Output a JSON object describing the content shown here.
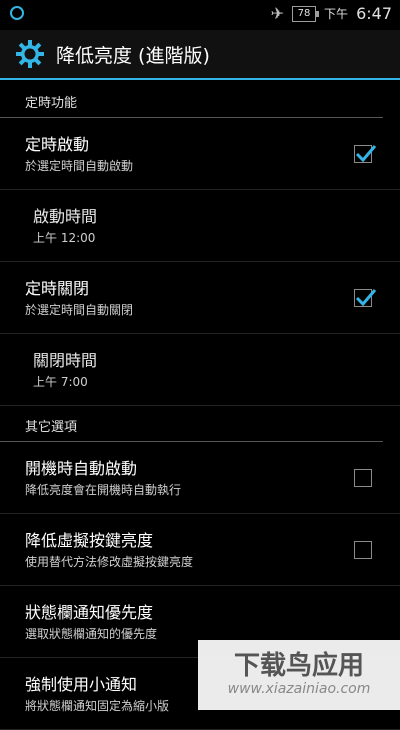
{
  "status_bar": {
    "battery": "78",
    "ampm": "下午",
    "time": "6:47",
    "icons": [
      "circle-status-icon",
      "airplane-icon",
      "battery-icon"
    ]
  },
  "action_bar": {
    "title": "降低亮度 (進階版)",
    "icon": "gear-icon"
  },
  "sections": [
    {
      "header": "定時功能",
      "items": [
        {
          "title": "定時啟動",
          "summary": "於選定時間自動啟動",
          "checked": true
        },
        {
          "title": "啟動時間",
          "summary": "上午 12:00"
        },
        {
          "title": "定時關閉",
          "summary": "於選定時間自動關閉",
          "checked": true
        },
        {
          "title": "關閉時間",
          "summary": "上午 7:00"
        }
      ]
    },
    {
      "header": "其它選項",
      "items": [
        {
          "title": "開機時自動啟動",
          "summary": "降低亮度會在開機時自動執行",
          "checked": false
        },
        {
          "title": "降低虛擬按鍵亮度",
          "summary": "使用替代方法修改虛擬按鍵亮度",
          "checked": false
        },
        {
          "title": "狀態欄通知優先度",
          "summary": "選取狀態欄通知的優先度"
        },
        {
          "title": "強制使用小通知",
          "summary": "將狀態欄通知固定為縮小版"
        }
      ]
    }
  ],
  "watermark": {
    "main": "下载鸟应用",
    "sub": "www.xiazainiao.com"
  },
  "colors": {
    "accent": "#33b5e5",
    "background": "#000000",
    "checkmark": "#33b5e5"
  }
}
